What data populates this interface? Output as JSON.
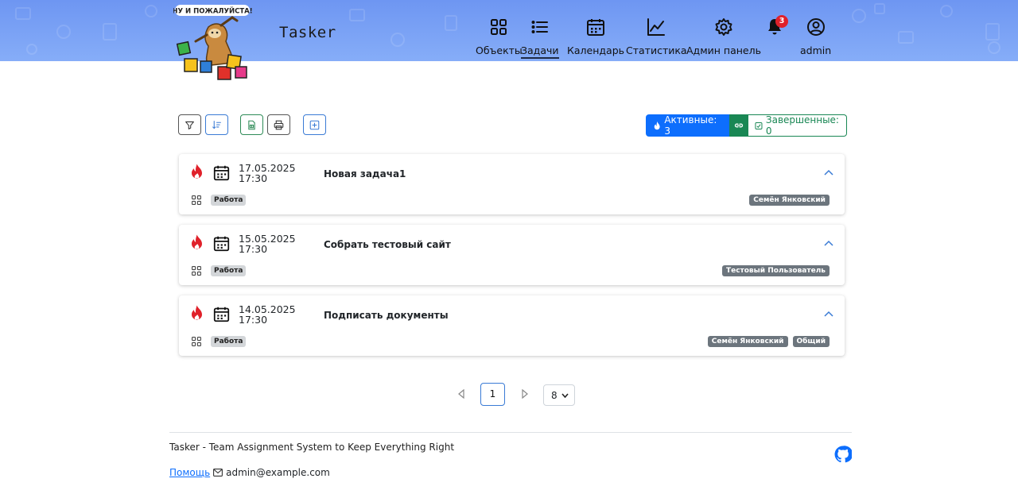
{
  "app": {
    "brand": "Tasker",
    "logo_text": "НУ И ПОЖАЛУЙСТА!"
  },
  "nav": {
    "objects": "Объекты",
    "tasks": "Задачи",
    "calendar": "Календарь",
    "stats": "Статистика",
    "admin_panel": "Админ панель",
    "notifications_count": "3",
    "user": "admin"
  },
  "toolbar": {
    "active_label": "Активные: 3",
    "done_label": "Завершенные: 0"
  },
  "tasks": [
    {
      "date": "17.05.2025",
      "time": "17:30",
      "title": "Новая задача1",
      "category": "Работа",
      "assignees": [
        "Семён Янковский"
      ]
    },
    {
      "date": "15.05.2025",
      "time": "17:30",
      "title": "Собрать тестовый сайт",
      "category": "Работа",
      "assignees": [
        "Тестовый Пользователь"
      ]
    },
    {
      "date": "14.05.2025",
      "time": "17:30",
      "title": "Подписать документы",
      "category": "Работа",
      "assignees": [
        "Семён Янковский",
        "Общий"
      ]
    }
  ],
  "pagination": {
    "current": "1",
    "page_size": "8"
  },
  "footer": {
    "tagline": "Tasker - Team Assignment System to Keep Everything Right",
    "help": "Помощь",
    "email": "admin@example.com"
  },
  "colors": {
    "header": "#7aa2f6",
    "primary": "#0d6efd",
    "success": "#198754",
    "badge": "#6c757d",
    "fire": "#e0212a"
  }
}
